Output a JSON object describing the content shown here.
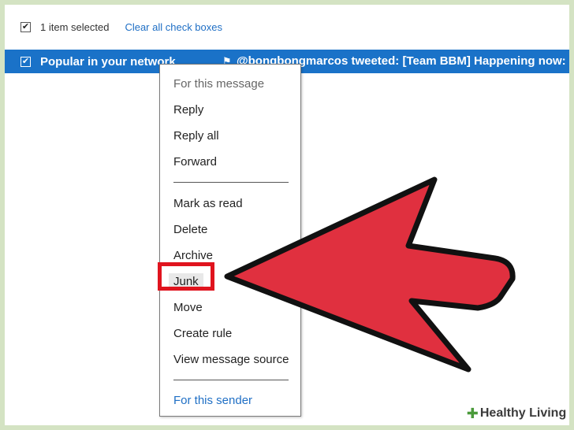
{
  "toolbar": {
    "selected_count": "1 item selected",
    "clear_link": "Clear all check boxes",
    "check_glyph": "✔"
  },
  "message": {
    "sender": "Popular in your network",
    "flag_icon": "flag-icon",
    "subject": "@bongbongmarcos tweeted: [Team BBM] Happening now:"
  },
  "context_menu": {
    "header_message": "For this message",
    "items": [
      "Reply",
      "Reply all",
      "Forward",
      "Mark as read",
      "Delete",
      "Archive",
      "Junk",
      "Move",
      "Create rule",
      "View message source"
    ],
    "header_sender": "For this sender"
  },
  "annotation": {
    "highlight_color": "#e0141e",
    "arrow_color": "#e0303f",
    "highlighted_item": "Junk"
  },
  "watermark": {
    "brand": "Healthy Living"
  },
  "colors": {
    "selected_row": "#1a72c8",
    "link": "#1f6fc5",
    "page_border": "#d4e3c3"
  }
}
